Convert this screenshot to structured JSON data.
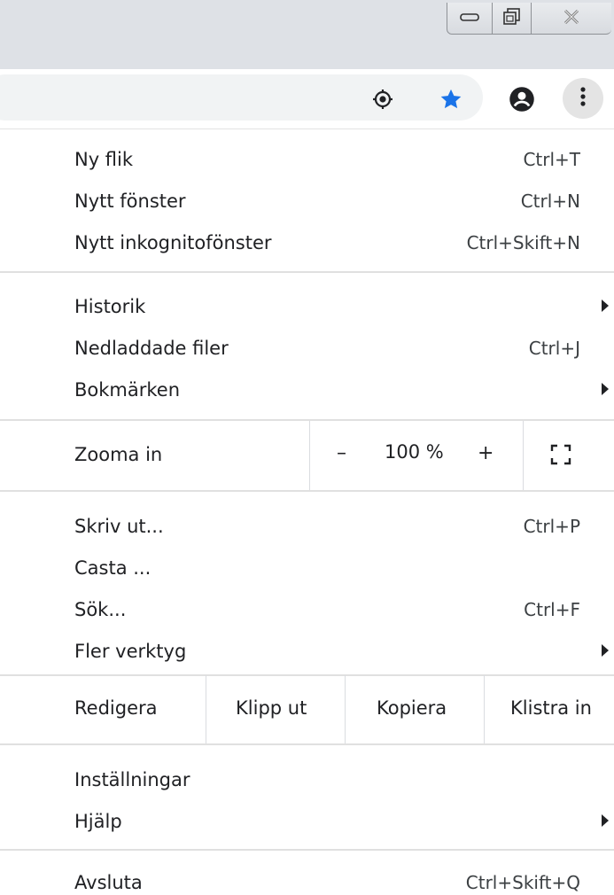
{
  "window": {
    "controls": [
      {
        "name": "minimize",
        "icon": "minimize-icon"
      },
      {
        "name": "restore",
        "icon": "restore-icon"
      },
      {
        "name": "close",
        "icon": "close-icon"
      }
    ]
  },
  "toolbar": {
    "icons": [
      "location-icon",
      "bookmark-star-icon",
      "profile-icon",
      "more-vert-icon"
    ],
    "star_color": "#1a73e8"
  },
  "menu": {
    "group1": [
      {
        "label": "Ny flik",
        "shortcut": "Ctrl+T"
      },
      {
        "label": "Nytt fönster",
        "shortcut": "Ctrl+N"
      },
      {
        "label": "Nytt inkognitofönster",
        "shortcut": "Ctrl+Skift+N"
      }
    ],
    "group2": [
      {
        "label": "Historik",
        "submenu": true
      },
      {
        "label": "Nedladdade filer",
        "shortcut": "Ctrl+J"
      },
      {
        "label": "Bokmärken",
        "submenu": true
      }
    ],
    "zoom": {
      "label": "Zooma in",
      "minus": "–",
      "value": "100 %",
      "plus": "+",
      "fullscreen_icon": "fullscreen-icon"
    },
    "group3": [
      {
        "label": "Skriv ut...",
        "shortcut": "Ctrl+P"
      },
      {
        "label": "Casta ..."
      },
      {
        "label": "Sök...",
        "shortcut": "Ctrl+F"
      },
      {
        "label": "Fler verktyg",
        "submenu": true
      }
    ],
    "edit": {
      "label": "Redigera",
      "cut": "Klipp ut",
      "copy": "Kopiera",
      "paste": "Klistra in"
    },
    "group4": [
      {
        "label": "Inställningar"
      },
      {
        "label": "Hjälp",
        "submenu": true
      }
    ],
    "group5": [
      {
        "label": "Avsluta",
        "shortcut": "Ctrl+Skift+Q"
      }
    ]
  }
}
